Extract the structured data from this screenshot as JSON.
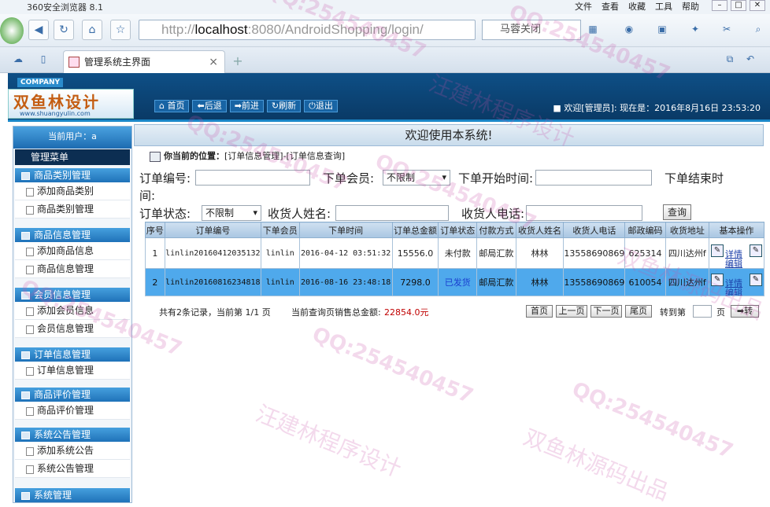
{
  "browser": {
    "title": "360安全浏览器 8.1",
    "menu": [
      "文件",
      "查看",
      "收藏",
      "工具",
      "帮助"
    ],
    "url_prefix": "http://",
    "url_host": "localhost",
    "url_rest": ":8080/AndroidShopping/login/",
    "search_text": "马蓉关闭",
    "tab_title": "管理系统主界面"
  },
  "header": {
    "company": "COMPANY",
    "brand": "双鱼林设计",
    "brand_url": "www.shuangyulin.com",
    "nav": [
      "首页",
      "后退",
      "前进",
      "刷新",
      "退出"
    ],
    "welcome": "欢迎[管理员]:  现在是：2016年8月16日 23:53:20"
  },
  "sidebar": {
    "current_user": "当前用户：a",
    "menu_title": "管理菜单",
    "groups": [
      {
        "title": "商品类别管理",
        "items": [
          "添加商品类别",
          "商品类别管理"
        ]
      },
      {
        "title": "商品信息管理",
        "items": [
          "添加商品信息",
          "商品信息管理"
        ]
      },
      {
        "title": "会员信息管理",
        "items": [
          "添加会员信息",
          "会员信息管理"
        ]
      },
      {
        "title": "订单信息管理",
        "items": [
          "订单信息管理"
        ]
      },
      {
        "title": "商品评价管理",
        "items": [
          "商品评价管理"
        ]
      },
      {
        "title": "系统公告管理",
        "items": [
          "添加系统公告",
          "系统公告管理"
        ]
      },
      {
        "title": "系统管理",
        "items": []
      }
    ]
  },
  "main": {
    "banner": "欢迎使用本系统!",
    "location_label": "你当前的位置：",
    "location_path": "[订单信息管理]-[订单信息查询]",
    "filters": {
      "order_no_label": "订单编号:",
      "member_label": "下单会员:",
      "member_value": "不限制",
      "start_label": "下单开始时间:",
      "end_label": "下单结束时",
      "end_label_wrap": "间:",
      "status_label": "订单状态:",
      "status_value": "不限制",
      "receiver_label": "收货人姓名:",
      "phone_label": "收货人电话:",
      "query_button": "查询"
    },
    "table": {
      "headers": [
        "序号",
        "订单编号",
        "下单会员",
        "下单时间",
        "订单总金额",
        "订单状态",
        "付款方式",
        "收货人姓名",
        "收货人电话",
        "邮政编码",
        "收货地址",
        "基本操作"
      ],
      "rows": [
        [
          "1",
          "linlin20160412035132",
          "linlin",
          "2016-04-12 03:51:32",
          "15556.0",
          "未付款",
          "邮局汇款",
          "林林",
          "13558690869",
          "625314",
          "四川达州f"
        ],
        [
          "2",
          "linlin20160816234818",
          "linlin",
          "2016-08-16 23:48:18",
          "7298.0",
          "已发货",
          "邮局汇款",
          "林林",
          "13558690869",
          "610054",
          "四川达州f"
        ]
      ],
      "op_detail": "详情",
      "op_edit": "编辑",
      "status2_color": "#1a3ed0"
    },
    "pager": {
      "summary": "共有2条记录，当前第 1/1 页",
      "sales_label": "当前查询页销售总金额:",
      "sales_value": "22854.0元",
      "buttons": [
        "首页",
        "上一页",
        "下一页",
        "尾页"
      ],
      "goto_label": "转到第",
      "goto_suffix": "页",
      "go_button": "➡转"
    }
  },
  "watermarks": [
    "QQ:254540457",
    "汪建林程序设计",
    "双鱼林源码出品"
  ],
  "colors": {
    "header_bg": "#0b3f6e",
    "accent_blue": "#1f72b9",
    "selected_row": "#4fa9ec",
    "sales_red": "#c00000"
  }
}
